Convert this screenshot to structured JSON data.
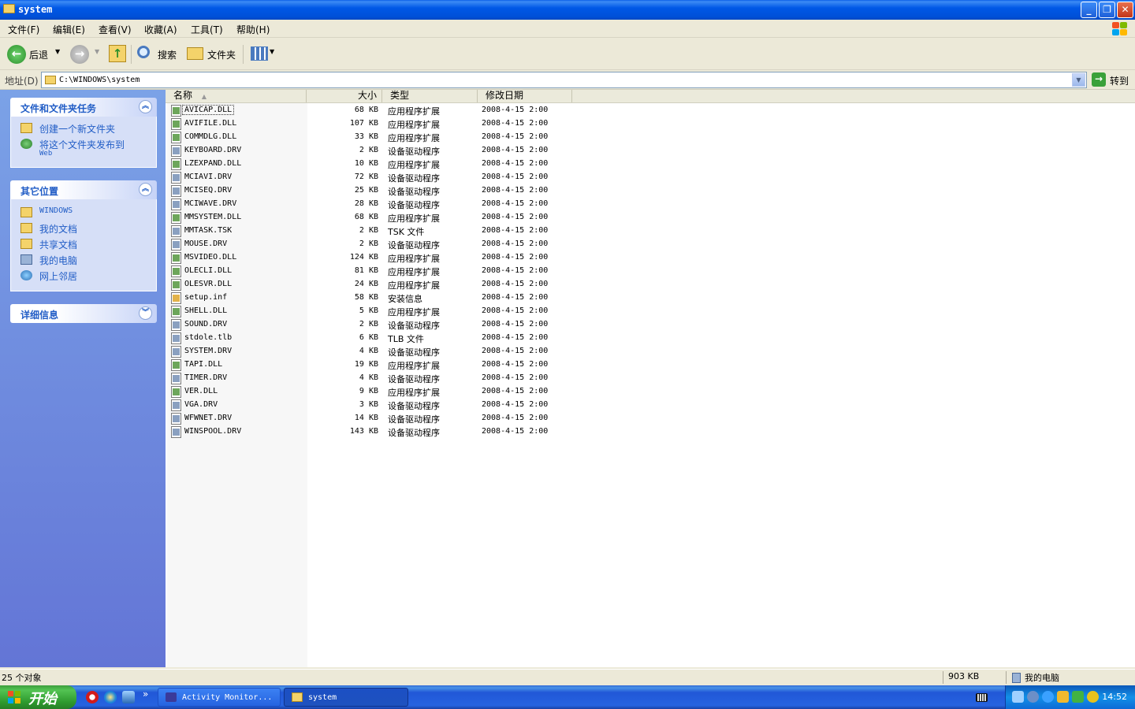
{
  "window": {
    "title": "system",
    "controls": {
      "minimize": "_",
      "restore": "❐",
      "close": "✕"
    }
  },
  "menubar": {
    "items": [
      "文件(F)",
      "编辑(E)",
      "查看(V)",
      "收藏(A)",
      "工具(T)",
      "帮助(H)"
    ]
  },
  "toolbar": {
    "back_label": "后退",
    "search_label": "搜索",
    "folders_label": "文件夹"
  },
  "address": {
    "label": "地址(D)",
    "value": "C:\\WINDOWS\\system",
    "go_label": "转到"
  },
  "tasks_panel": {
    "title": "文件和文件夹任务",
    "items": [
      {
        "label": "创建一个新文件夹",
        "icon": "new-folder-icon"
      },
      {
        "label": "将这个文件夹发布到",
        "sub": "Web",
        "icon": "publish-web-icon"
      }
    ]
  },
  "places_panel": {
    "title": "其它位置",
    "items": [
      {
        "label": "WINDOWS",
        "icon": "folder-icon"
      },
      {
        "label": "我的文档",
        "icon": "my-documents-icon"
      },
      {
        "label": "共享文档",
        "icon": "shared-folder-icon"
      },
      {
        "label": "我的电脑",
        "icon": "my-computer-icon"
      },
      {
        "label": "网上邻居",
        "icon": "network-icon"
      }
    ]
  },
  "details_panel": {
    "title": "详细信息"
  },
  "columns": {
    "name": "名称",
    "size": "大小",
    "type": "类型",
    "modified": "修改日期"
  },
  "files": [
    {
      "name": "AVICAP.DLL",
      "size": "68 KB",
      "type": "应用程序扩展",
      "modified": "2008-4-15 2:00",
      "kind": "dll"
    },
    {
      "name": "AVIFILE.DLL",
      "size": "107 KB",
      "type": "应用程序扩展",
      "modified": "2008-4-15 2:00",
      "kind": "dll"
    },
    {
      "name": "COMMDLG.DLL",
      "size": "33 KB",
      "type": "应用程序扩展",
      "modified": "2008-4-15 2:00",
      "kind": "dll"
    },
    {
      "name": "KEYBOARD.DRV",
      "size": "2 KB",
      "type": "设备驱动程序",
      "modified": "2008-4-15 2:00",
      "kind": "drv"
    },
    {
      "name": "LZEXPAND.DLL",
      "size": "10 KB",
      "type": "应用程序扩展",
      "modified": "2008-4-15 2:00",
      "kind": "dll"
    },
    {
      "name": "MCIAVI.DRV",
      "size": "72 KB",
      "type": "设备驱动程序",
      "modified": "2008-4-15 2:00",
      "kind": "drv"
    },
    {
      "name": "MCISEQ.DRV",
      "size": "25 KB",
      "type": "设备驱动程序",
      "modified": "2008-4-15 2:00",
      "kind": "drv"
    },
    {
      "name": "MCIWAVE.DRV",
      "size": "28 KB",
      "type": "设备驱动程序",
      "modified": "2008-4-15 2:00",
      "kind": "drv"
    },
    {
      "name": "MMSYSTEM.DLL",
      "size": "68 KB",
      "type": "应用程序扩展",
      "modified": "2008-4-15 2:00",
      "kind": "dll"
    },
    {
      "name": "MMTASK.TSK",
      "size": "2 KB",
      "type": "TSK 文件",
      "modified": "2008-4-15 2:00",
      "kind": "drv"
    },
    {
      "name": "MOUSE.DRV",
      "size": "2 KB",
      "type": "设备驱动程序",
      "modified": "2008-4-15 2:00",
      "kind": "drv"
    },
    {
      "name": "MSVIDEO.DLL",
      "size": "124 KB",
      "type": "应用程序扩展",
      "modified": "2008-4-15 2:00",
      "kind": "dll"
    },
    {
      "name": "OLECLI.DLL",
      "size": "81 KB",
      "type": "应用程序扩展",
      "modified": "2008-4-15 2:00",
      "kind": "dll"
    },
    {
      "name": "OLESVR.DLL",
      "size": "24 KB",
      "type": "应用程序扩展",
      "modified": "2008-4-15 2:00",
      "kind": "dll"
    },
    {
      "name": "setup.inf",
      "size": "58 KB",
      "type": "安装信息",
      "modified": "2008-4-15 2:00",
      "kind": "inf"
    },
    {
      "name": "SHELL.DLL",
      "size": "5 KB",
      "type": "应用程序扩展",
      "modified": "2008-4-15 2:00",
      "kind": "dll"
    },
    {
      "name": "SOUND.DRV",
      "size": "2 KB",
      "type": "设备驱动程序",
      "modified": "2008-4-15 2:00",
      "kind": "drv"
    },
    {
      "name": "stdole.tlb",
      "size": "6 KB",
      "type": "TLB 文件",
      "modified": "2008-4-15 2:00",
      "kind": "drv"
    },
    {
      "name": "SYSTEM.DRV",
      "size": "4 KB",
      "type": "设备驱动程序",
      "modified": "2008-4-15 2:00",
      "kind": "drv"
    },
    {
      "name": "TAPI.DLL",
      "size": "19 KB",
      "type": "应用程序扩展",
      "modified": "2008-4-15 2:00",
      "kind": "dll"
    },
    {
      "name": "TIMER.DRV",
      "size": "4 KB",
      "type": "设备驱动程序",
      "modified": "2008-4-15 2:00",
      "kind": "drv"
    },
    {
      "name": "VER.DLL",
      "size": "9 KB",
      "type": "应用程序扩展",
      "modified": "2008-4-15 2:00",
      "kind": "dll"
    },
    {
      "name": "VGA.DRV",
      "size": "3 KB",
      "type": "设备驱动程序",
      "modified": "2008-4-15 2:00",
      "kind": "drv"
    },
    {
      "name": "WFWNET.DRV",
      "size": "14 KB",
      "type": "设备驱动程序",
      "modified": "2008-4-15 2:00",
      "kind": "drv"
    },
    {
      "name": "WINSPOOL.DRV",
      "size": "143 KB",
      "type": "设备驱动程序",
      "modified": "2008-4-15 2:00",
      "kind": "drv"
    }
  ],
  "statusbar": {
    "count": "25 个对象",
    "size": "903 KB",
    "zone": "我的电脑"
  },
  "taskbar": {
    "start_label": "开始",
    "more": "»",
    "buttons": [
      {
        "label": "Activity Monitor..."
      },
      {
        "label": "system"
      }
    ],
    "clock": "14:52"
  },
  "colors": {
    "title_blue": "#0058e6",
    "panel_blue": "#215dc6",
    "start_green": "#3c9e3c"
  }
}
